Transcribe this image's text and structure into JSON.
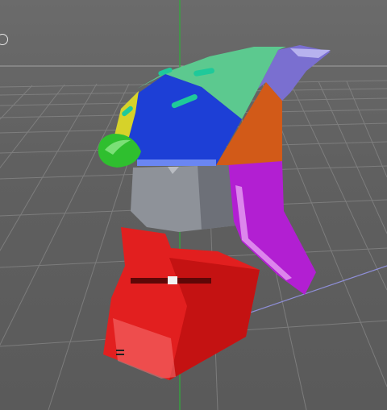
{
  "viewport": {
    "background": "#606060",
    "grid_color": "#8a8a8a",
    "y_axis_color": "#2fae3a",
    "x_axis_color": "#8f8fd8"
  },
  "model": {
    "name": "helmet",
    "parts": [
      {
        "name": "crest-yellow",
        "color": "#d6d22a"
      },
      {
        "name": "cap-green",
        "color": "#2fbf2f"
      },
      {
        "name": "panel-blue",
        "color": "#1d3fd6"
      },
      {
        "name": "panel-mint",
        "color": "#5cc98f"
      },
      {
        "name": "fin-lavender",
        "color": "#7a6fd0"
      },
      {
        "name": "panel-orange",
        "color": "#d25a18"
      },
      {
        "name": "cheek-magenta",
        "color": "#b21fd2"
      },
      {
        "name": "inner-gray",
        "color": "#8e9299"
      },
      {
        "name": "jaw-red",
        "color": "#e21f1f"
      },
      {
        "name": "slot-teal",
        "color": "#1fc99a"
      }
    ]
  },
  "hud": {
    "indicator": "circle-icon"
  }
}
